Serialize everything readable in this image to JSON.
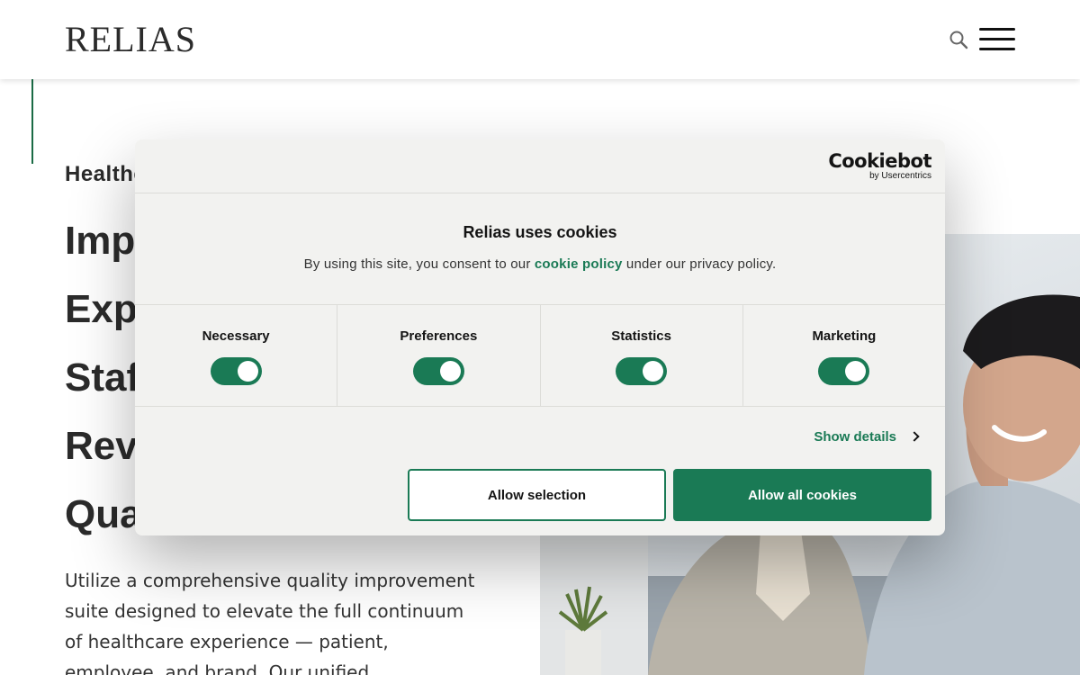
{
  "header": {
    "logo_text": "RELIAS",
    "colors": {
      "brand_green": "#1a6b45",
      "text": "#2b2b2b"
    }
  },
  "page": {
    "eyebrow": "Healthc",
    "hero_lines": [
      "Impr",
      "Expe",
      "Staf",
      "Revi",
      "Qua"
    ],
    "paragraph": "Utilize a comprehensive quality improvement suite designed to elevate the full continuum of healthcare experience — patient, employee, and brand. Our unified"
  },
  "cookie_dialog": {
    "provider_name": "Cookiebot",
    "provider_sub": "by Usercentrics",
    "title": "Relias uses cookies",
    "text_before": "By using this site, you consent to our ",
    "link_text": "cookie policy",
    "text_after": " under our privacy policy.",
    "toggles": [
      {
        "label": "Necessary",
        "checked": true
      },
      {
        "label": "Preferences",
        "checked": true
      },
      {
        "label": "Statistics",
        "checked": true
      },
      {
        "label": "Marketing",
        "checked": true
      }
    ],
    "show_details": "Show details",
    "allow_selection": "Allow selection",
    "allow_all": "Allow all cookies",
    "accent_color": "#1a7a55"
  }
}
